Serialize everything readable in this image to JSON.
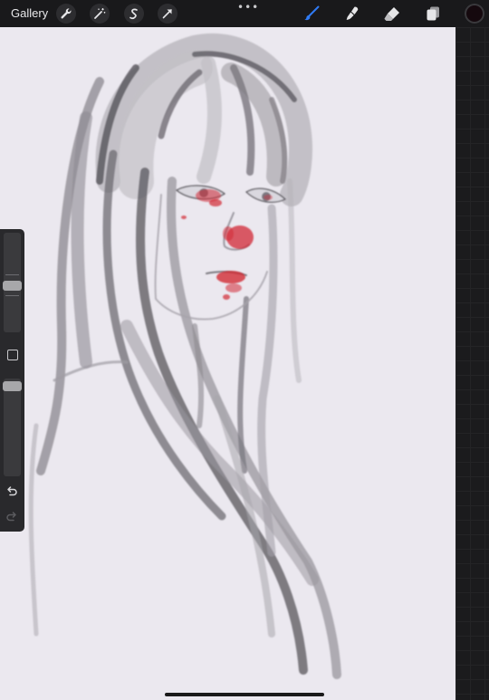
{
  "toolbar": {
    "gallery_label": "Gallery",
    "left_tools": [
      "wrench-icon",
      "magic-wand-icon",
      "selection-icon",
      "transform-arrow-icon"
    ],
    "more_label": "•••",
    "right_tools": [
      "brush-icon",
      "smudge-icon",
      "eraser-icon",
      "layers-icon"
    ],
    "active_tool": "brush-icon",
    "accent_color": "#2f7bf5",
    "current_color": "#15090e"
  },
  "sidebar": {
    "brush_size_level": 0.46,
    "opacity_level": 0.97,
    "undo_icon": "undo-icon",
    "redo_icon": "redo-icon"
  },
  "canvas": {
    "background": "#ebe8ef",
    "artwork": "sketch-portrait"
  }
}
